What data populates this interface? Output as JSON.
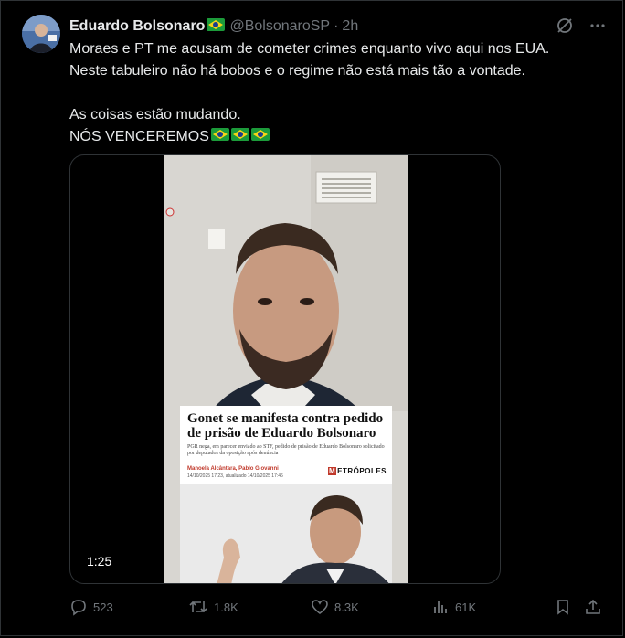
{
  "post": {
    "author_name": "Eduardo Bolsonaro",
    "handle": "@BolsonaroSP",
    "separator": "·",
    "time": "2h",
    "text_lines": [
      "Moraes e PT me acusam de cometer crimes enquanto vivo aqui nos EUA.",
      "Neste tabuleiro não há bobos e o regime não está mais tão a vontade.",
      "",
      "As coisas estão mudando.",
      "NÓS VENCEREMOS"
    ],
    "icons": {
      "grok": "grok-slash-icon",
      "more": "more-icon",
      "flag": "brazil-flag-icon"
    }
  },
  "media": {
    "duration": "1:25",
    "article": {
      "headline": "Gonet se manifesta contra pedido de prisão de Eduardo Bolsonaro",
      "subline": "PGR nega, em parecer enviado ao STF, pedido de prisão de Eduardo Bolsonaro solicitado por deputados da oposição após denúncia",
      "authors": "Manoela Alcântara, Pablo Giovanni",
      "dates": "14/10/2025 17:23, atualizado 14/10/2025 17:46",
      "outlet_m": "M",
      "outlet_rest": "ETRÓPOLES"
    }
  },
  "actions": {
    "replies": "523",
    "reposts": "1.8K",
    "likes": "8.3K",
    "views": "61K"
  },
  "colors": {
    "background": "#000000",
    "text": "#e7e9ea",
    "muted": "#71767b",
    "border": "#2f3336"
  }
}
